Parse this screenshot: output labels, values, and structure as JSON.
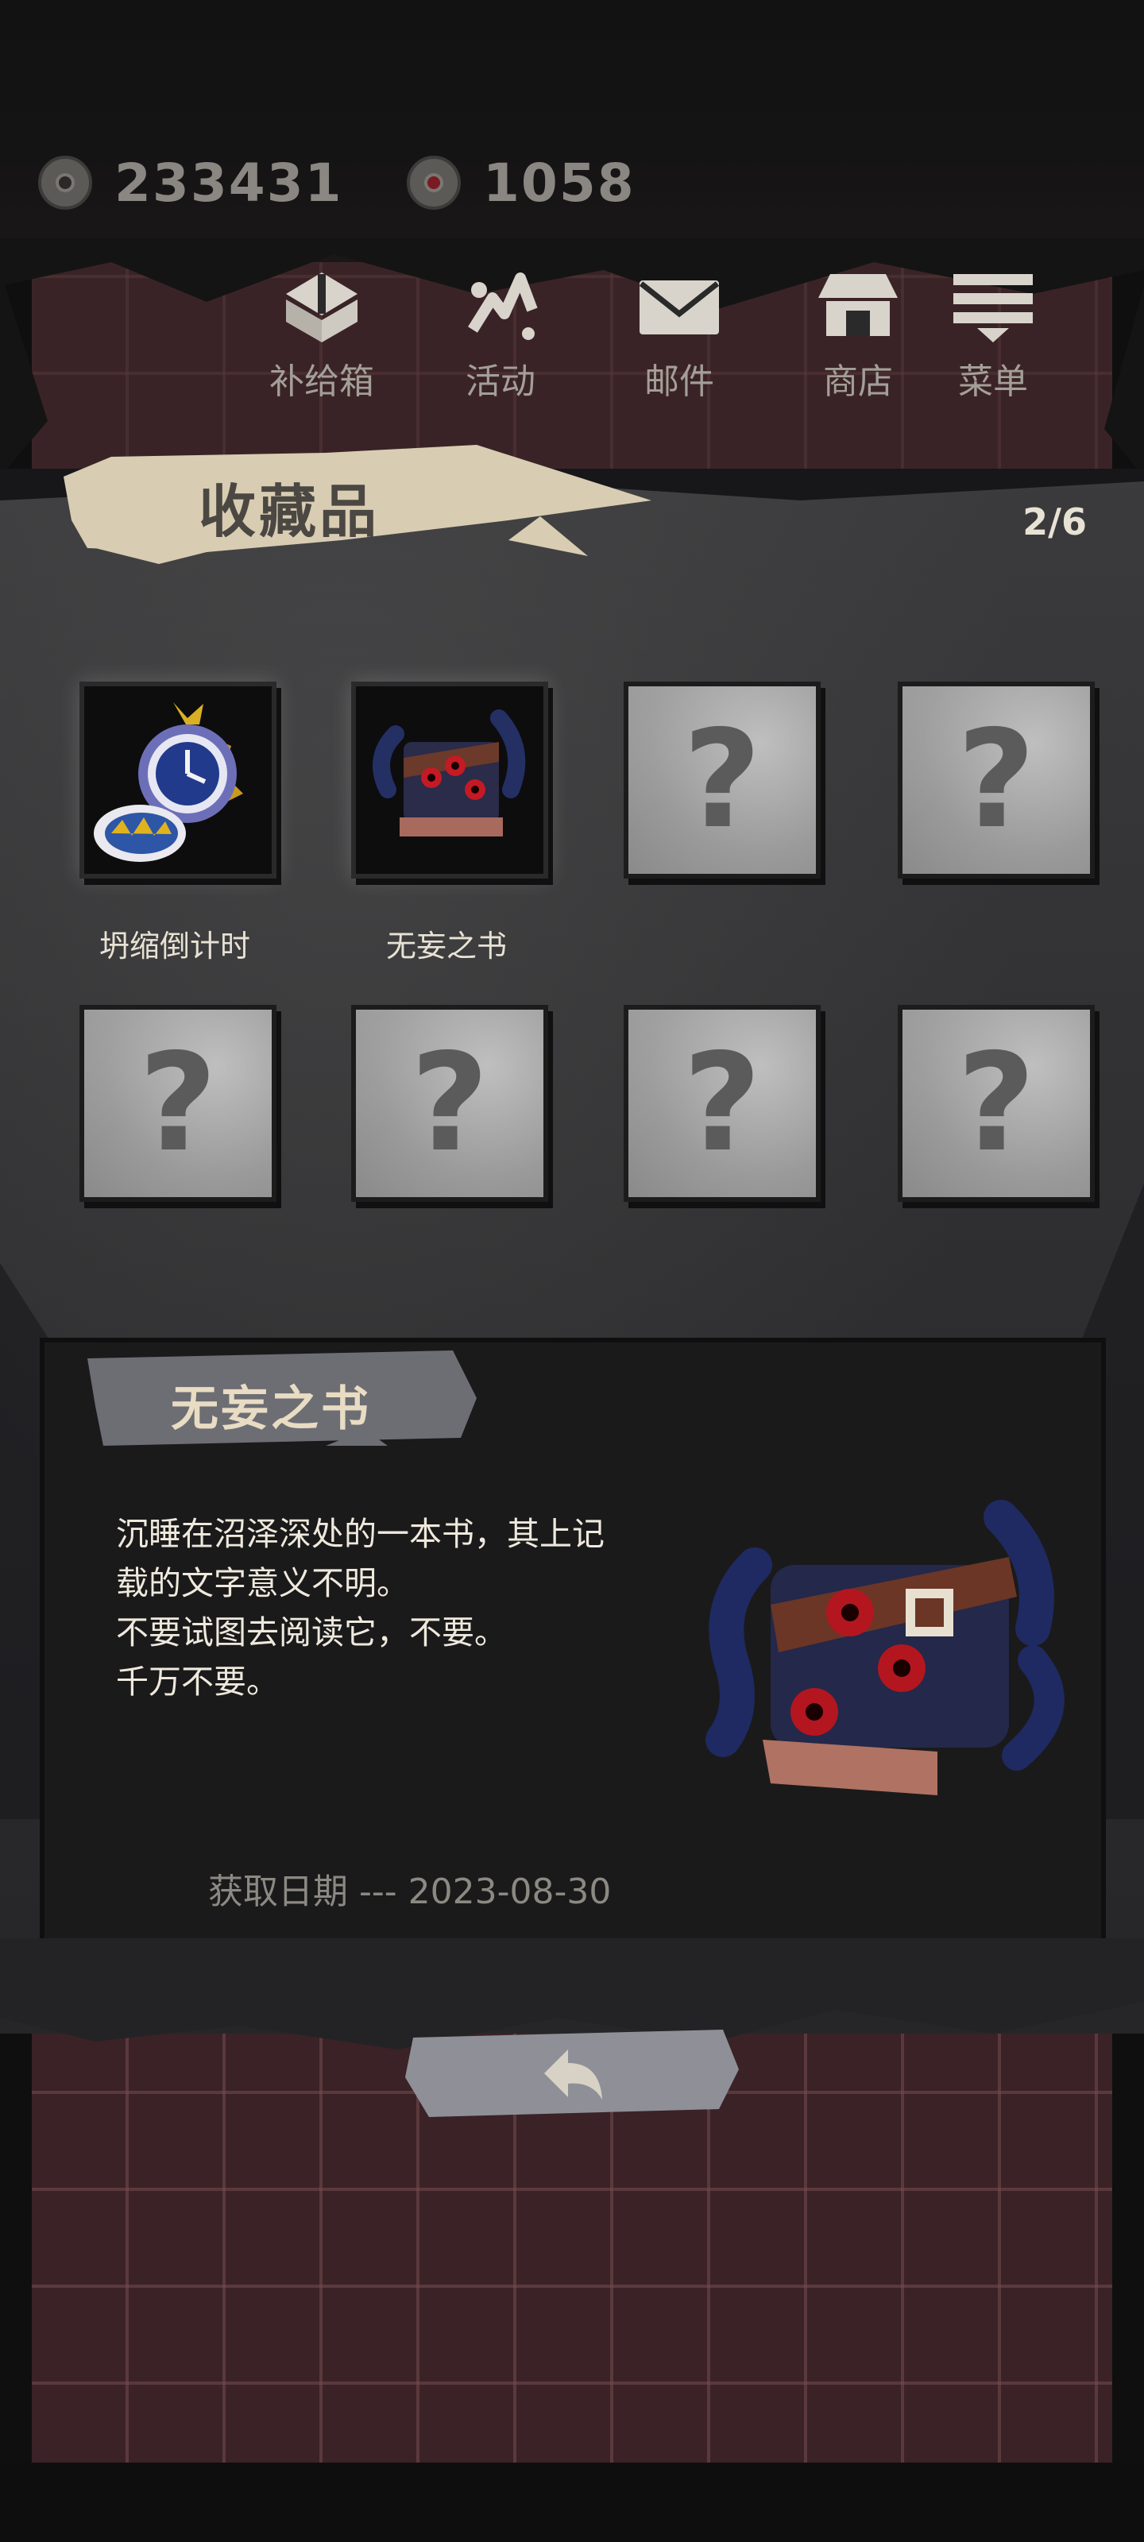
{
  "currencies": [
    {
      "icon": "eye-coin-icon",
      "value": "233431"
    },
    {
      "icon": "red-eye-coin-icon",
      "value": "1058"
    }
  ],
  "nav": [
    {
      "icon": "supply-box-icon",
      "label": "补给箱"
    },
    {
      "icon": "activity-icon",
      "label": "活动"
    },
    {
      "icon": "mail-icon",
      "label": "邮件"
    },
    {
      "icon": "shop-icon",
      "label": "商店"
    },
    {
      "icon": "menu-icon",
      "label": "菜单"
    }
  ],
  "collection": {
    "title": "收藏品",
    "page": "2/6",
    "slots": [
      {
        "label": "坍缩倒计时",
        "icon": "pocket-watch-icon"
      },
      {
        "label": "无妄之书",
        "icon": "tentacle-book-icon"
      },
      {
        "label": "",
        "icon": "unknown-item-icon"
      },
      {
        "label": "",
        "icon": "unknown-item-icon"
      },
      {
        "label": "",
        "icon": "unknown-item-icon"
      },
      {
        "label": "",
        "icon": "unknown-item-icon"
      },
      {
        "label": "",
        "icon": "unknown-item-icon"
      },
      {
        "label": "",
        "icon": "unknown-item-icon"
      }
    ],
    "unknown_mark": "?"
  },
  "detail": {
    "title": "无妄之书",
    "description_lines": [
      "沉睡在沼泽深处的一本书，其上记",
      "载的文字意义不明。",
      "不要试图去阅读它，不要。",
      "千万不要。"
    ],
    "acquired": "获取日期 --- 2023-08-30",
    "icon": "tentacle-book-icon"
  },
  "back": {
    "icon": "back-arrow-icon"
  },
  "colors": {
    "banner": "#d8ccb2",
    "panel": "#1a1a1b",
    "empty_slot": "#9a9a9a",
    "accent_red": "#b3161f"
  }
}
